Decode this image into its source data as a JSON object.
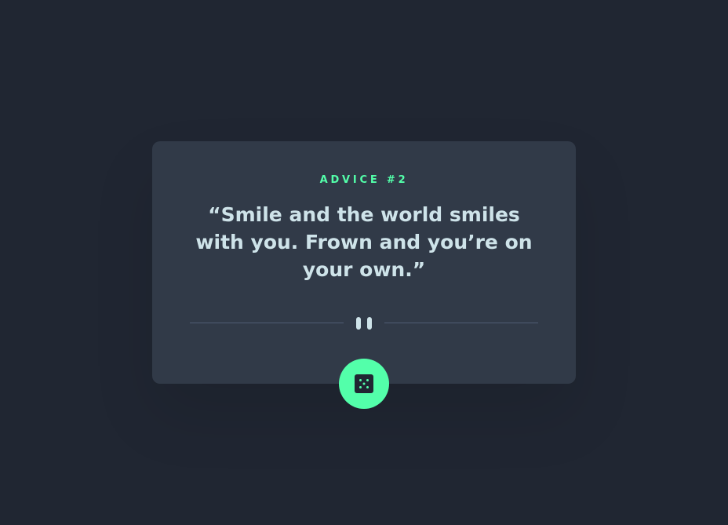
{
  "advice": {
    "id_label": "ADVICE #2",
    "quote": "“Smile and the world smiles with you. Frown and you’re on your own.”"
  },
  "divider": {
    "icon": "pause-icon"
  },
  "dice_button": {
    "icon": "dice-icon"
  },
  "colors": {
    "background": "#202632",
    "card": "#313a48",
    "accent": "#53ffaa",
    "text": "#cee3e9",
    "divider": "#4f5d74"
  }
}
